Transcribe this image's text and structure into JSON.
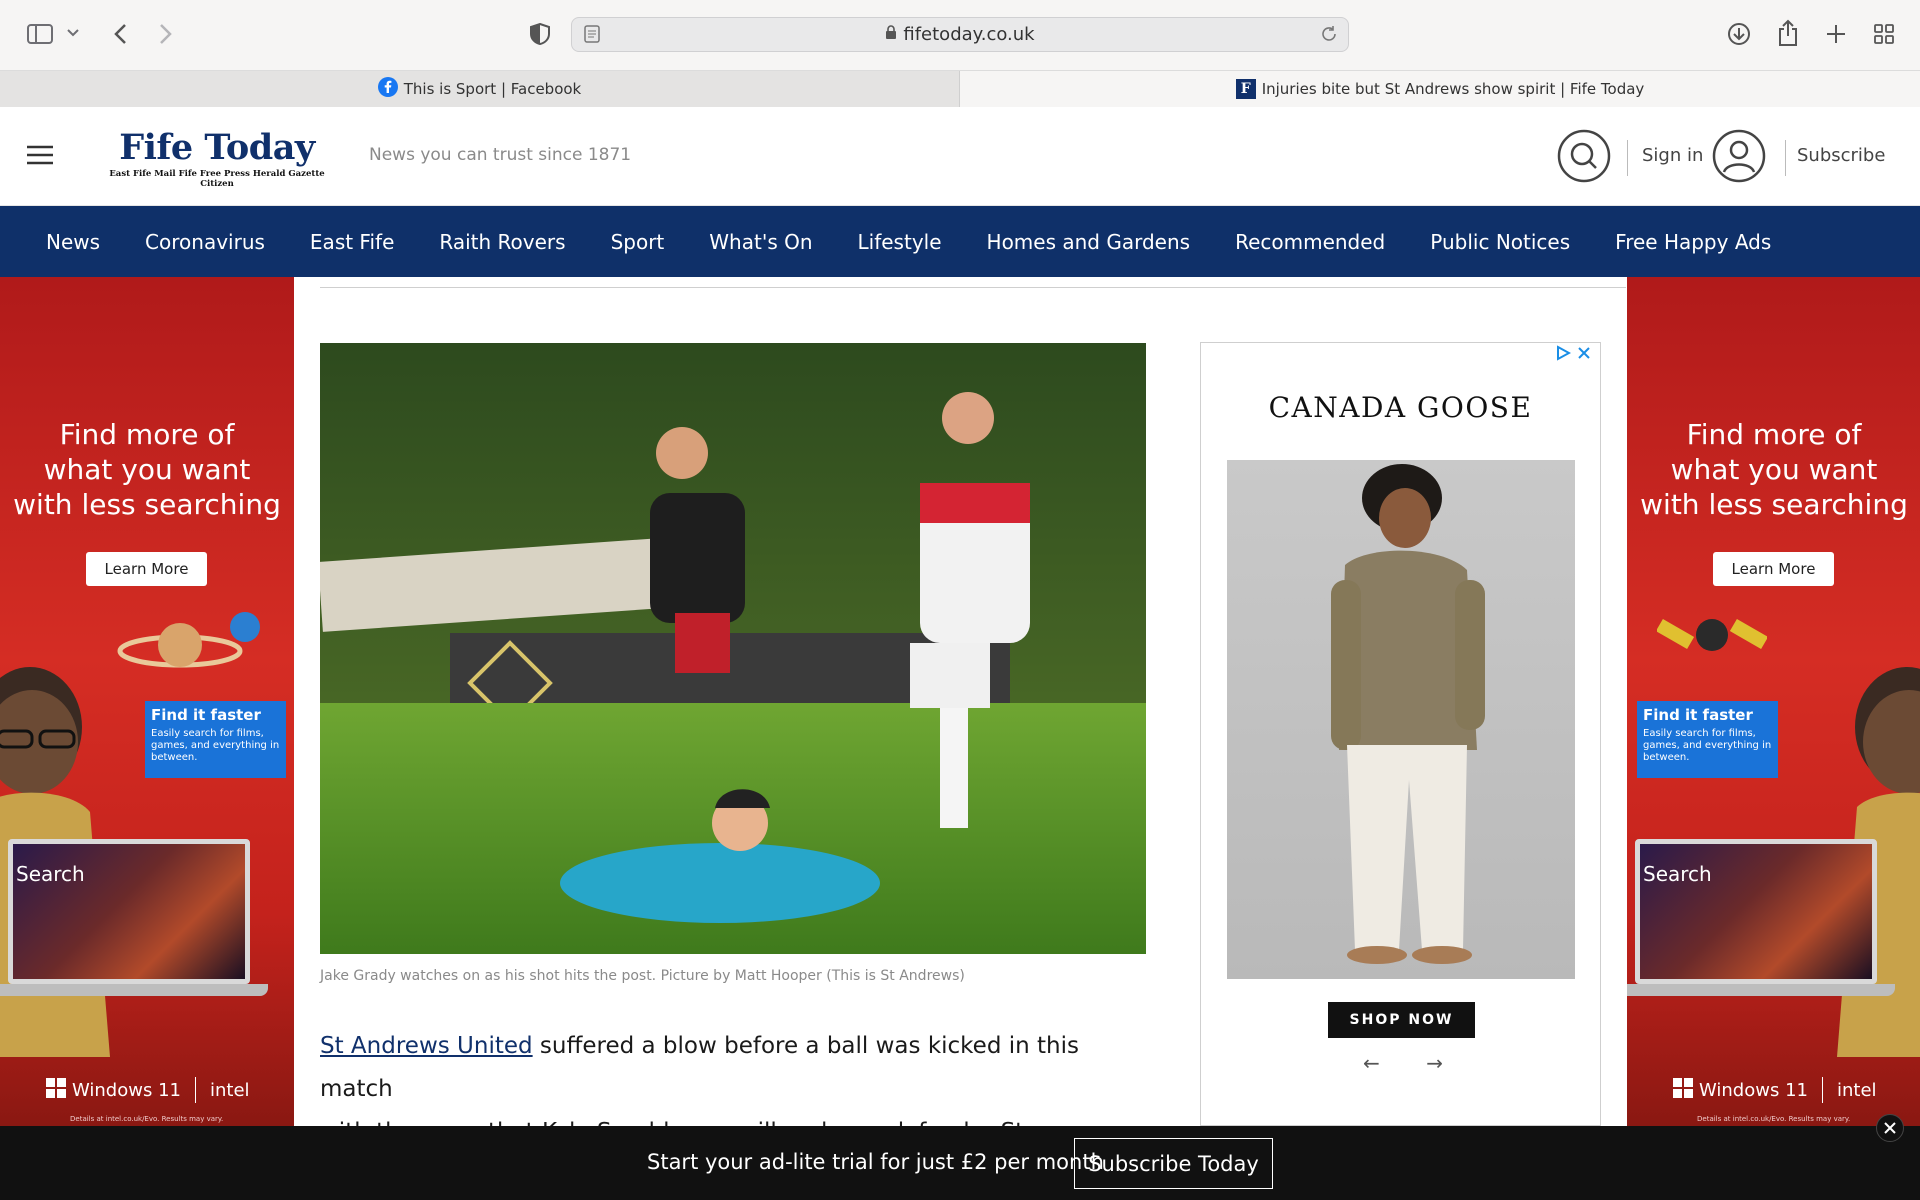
{
  "browser": {
    "url": "fifetoday.co.uk",
    "tabs": [
      {
        "title": "This is Sport | Facebook",
        "icon": "facebook-icon",
        "active": false
      },
      {
        "title": "Injuries bite but St Andrews show spirit | Fife Today",
        "icon": "fifetoday-favicon",
        "active": true
      }
    ]
  },
  "header": {
    "logo_title": "Fife Today",
    "logo_subtitle": "East Fife Mail  Fife Free Press  Herald  Gazette  Citizen",
    "tagline": "News you can trust since 1871",
    "sign_in": "Sign in",
    "subscribe": "Subscribe"
  },
  "nav": {
    "items": [
      "News",
      "Coronavirus",
      "East Fife",
      "Raith Rovers",
      "Sport",
      "What's On",
      "Lifestyle",
      "Homes and Gardens",
      "Recommended",
      "Public Notices",
      "Free Happy Ads"
    ]
  },
  "side_ad": {
    "headline_1": "Find more of",
    "headline_2": "what you want",
    "headline_3": "with less searching",
    "button": "Learn More",
    "card_title": "Find it faster",
    "card_desc": "Easily search for films, games, and everything in between.",
    "search_label": "Search",
    "brand_1": "Windows 11",
    "brand_2": "intel",
    "fine_print": "Details at intel.co.uk/Evo. Results may vary."
  },
  "article": {
    "caption": "Jake Grady watches on as his shot hits the post. Picture by Matt Hooper (This is St Andrews)",
    "link_text": "St Andrews United",
    "para_rest_1": " suffered a blow before a ball was kicked in this match",
    "para_line_2": "with the news that Kyle Sneddon was ill and new defender Steven"
  },
  "display_ad": {
    "brand": "CANADA GOOSE",
    "cta": "SHOP NOW",
    "prev": "←",
    "next": "→"
  },
  "bottom_bar": {
    "text": "Start your ad-lite trial for just £2 per month",
    "button": "Subscribe Today"
  },
  "colors": {
    "nav_bg": "#0f3069",
    "brand_blue": "#10306b",
    "ad_red": "#d52d24",
    "bottom_bar": "#111111"
  }
}
